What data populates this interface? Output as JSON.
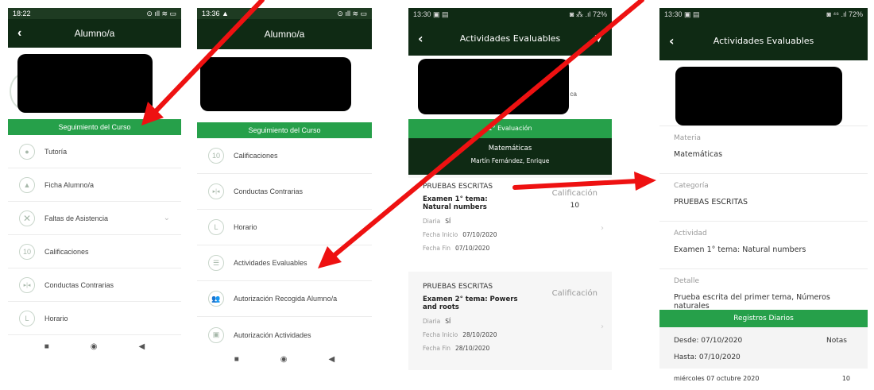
{
  "phone1": {
    "status_time": "18:22",
    "status_icons": "⊙ ıll ≋ ▭",
    "title": "Alumno/a",
    "section": "Seguimiento del Curso",
    "items": [
      {
        "label": "Tutoría",
        "icon": "person-icon"
      },
      {
        "label": "Ficha Alumno/a",
        "icon": "graduation-cap-icon"
      },
      {
        "label": "Faltas de Asistencia",
        "icon": "x-icon"
      },
      {
        "label": "Calificaciones",
        "icon": "ten-icon"
      },
      {
        "label": "Conductas Contrarias",
        "icon": "arrows-icon"
      },
      {
        "label": "Horario",
        "icon": "clock-icon"
      }
    ]
  },
  "phone2": {
    "status_time": "13:36 ▲",
    "status_icons": "⊙ ıll ≋ ▭",
    "title": "Alumno/a",
    "section": "Seguimiento del Curso",
    "items": [
      {
        "label": "Calificaciones",
        "icon": "ten-icon"
      },
      {
        "label": "Conductas Contrarias",
        "icon": "arrows-icon"
      },
      {
        "label": "Horario",
        "icon": "clock-icon"
      },
      {
        "label": "Actividades Evaluables",
        "icon": "list-icon"
      },
      {
        "label": "Autorización Recogida Alumno/a",
        "icon": "people-icon"
      },
      {
        "label": "Autorización Actividades",
        "icon": "clipboard-icon"
      }
    ]
  },
  "phone3": {
    "status_time": "13:30 ▣ ▤",
    "status_icons": "◙ ⁂ .ıl 72%",
    "title": "Actividades Evaluables",
    "partial_text": "ca",
    "evaluation": "1° Evaluación",
    "subject": "Matemáticas",
    "teacher": "Martín Fernández, Enrique",
    "cards": [
      {
        "category": "PRUEBAS ESCRITAS",
        "name": "Examen 1° tema: Natural numbers",
        "calif_label": "Calificación",
        "calif_value": "10",
        "diaria_label": "Diaria",
        "diaria_value": "SÍ",
        "inicio_label": "Fecha Inicio",
        "inicio_value": "07/10/2020",
        "fin_label": "Fecha Fin",
        "fin_value": "07/10/2020"
      },
      {
        "category": "PRUEBAS ESCRITAS",
        "name": "Examen 2° tema: Powers and roots",
        "calif_label": "Calificación",
        "calif_value": "",
        "diaria_label": "Diaria",
        "diaria_value": "SÍ",
        "inicio_label": "Fecha Inicio",
        "inicio_value": "28/10/2020",
        "fin_label": "Fecha Fin",
        "fin_value": "28/10/2020"
      }
    ]
  },
  "phone4": {
    "status_time": "13:30 ▣ ▤",
    "status_icons": "◙ ⁴⁶ .ıl 72%",
    "title": "Actividades Evaluables",
    "fields": [
      {
        "label": "Materia",
        "value": "Matemáticas"
      },
      {
        "label": "Categoría",
        "value": "PRUEBAS ESCRITAS"
      },
      {
        "label": "Actividad",
        "value": "Examen 1° tema: Natural numbers"
      },
      {
        "label": "Detalle",
        "value": "Prueba escrita del primer tema, Números naturales"
      }
    ],
    "registros": "Registros Diarios",
    "desde": "Desde: 07/10/2020",
    "hasta": "Hasta: 07/10/2020",
    "notas": "Notas",
    "entry_date": "miércoles 07 octubre 2020",
    "entry_value": "10"
  },
  "nav": {
    "square": "■",
    "circle": "◉",
    "back": "◀"
  },
  "colors": {
    "dark_green": "#0f2a14",
    "accent_green": "#26a04a",
    "arrow_red": "#ee1111"
  }
}
